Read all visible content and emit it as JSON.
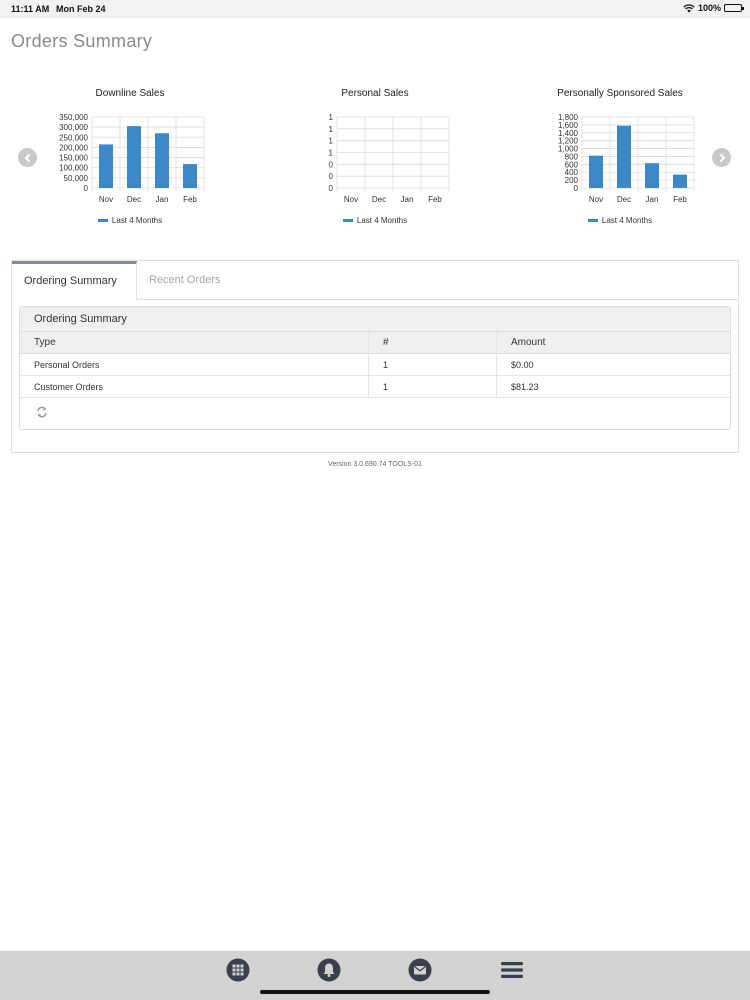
{
  "status": {
    "time": "11:11 AM",
    "date": "Mon Feb 24",
    "battery": "100%"
  },
  "page": {
    "title": "Orders Summary"
  },
  "chart_data": [
    {
      "type": "bar",
      "title": "Downline Sales",
      "categories": [
        "Nov",
        "Dec",
        "Jan",
        "Feb"
      ],
      "values": [
        215000,
        305000,
        270000,
        118000
      ],
      "yticks": [
        "350,000",
        "300,000",
        "250,000",
        "200,000",
        "150,000",
        "100,000",
        "50,000",
        "0"
      ],
      "ylim": [
        0,
        350000
      ],
      "legend": "Last 4 Months",
      "color": "#3d89c7"
    },
    {
      "type": "bar",
      "title": "Personal Sales",
      "categories": [
        "Nov",
        "Dec",
        "Jan",
        "Feb"
      ],
      "values": [
        0,
        0,
        0,
        0
      ],
      "yticks": [
        "1",
        "1",
        "1",
        "1",
        "0",
        "0",
        "0"
      ],
      "ylim": [
        0,
        1
      ],
      "legend": "Last 4 Months",
      "color": "#3d89c7"
    },
    {
      "type": "bar",
      "title": "Personally Sponsored Sales",
      "categories": [
        "Nov",
        "Dec",
        "Jan",
        "Feb"
      ],
      "values": [
        820,
        1580,
        630,
        340
      ],
      "yticks": [
        "1,800",
        "1,600",
        "1,400",
        "1,200",
        "1,000",
        "800",
        "600",
        "400",
        "200",
        "0"
      ],
      "ylim": [
        0,
        1800
      ],
      "legend": "Last 4 Months",
      "color": "#3d89c7"
    }
  ],
  "tabs": {
    "active": "Ordering Summary",
    "inactive": "Recent Orders"
  },
  "summary": {
    "heading": "Ordering Summary",
    "columns": [
      "Type",
      "#",
      "Amount"
    ],
    "rows": [
      {
        "type": "Personal Orders",
        "count": "1",
        "amount": "$0.00"
      },
      {
        "type": "Customer Orders",
        "count": "1",
        "amount": "$81.23"
      }
    ]
  },
  "footer": {
    "version": "Version 3.0.690.74 TOOLS-01"
  },
  "icons": {
    "prev": "chevron-left-icon",
    "next": "chevron-right-icon",
    "refresh": "refresh-icon",
    "grid": "grid-icon",
    "bell": "bell-icon",
    "mail": "mail-icon",
    "menu": "menu-icon"
  },
  "colors": {
    "bar": "#3d89c7",
    "link": "#8cbf3f",
    "tab_accent": "#7f8f95"
  }
}
